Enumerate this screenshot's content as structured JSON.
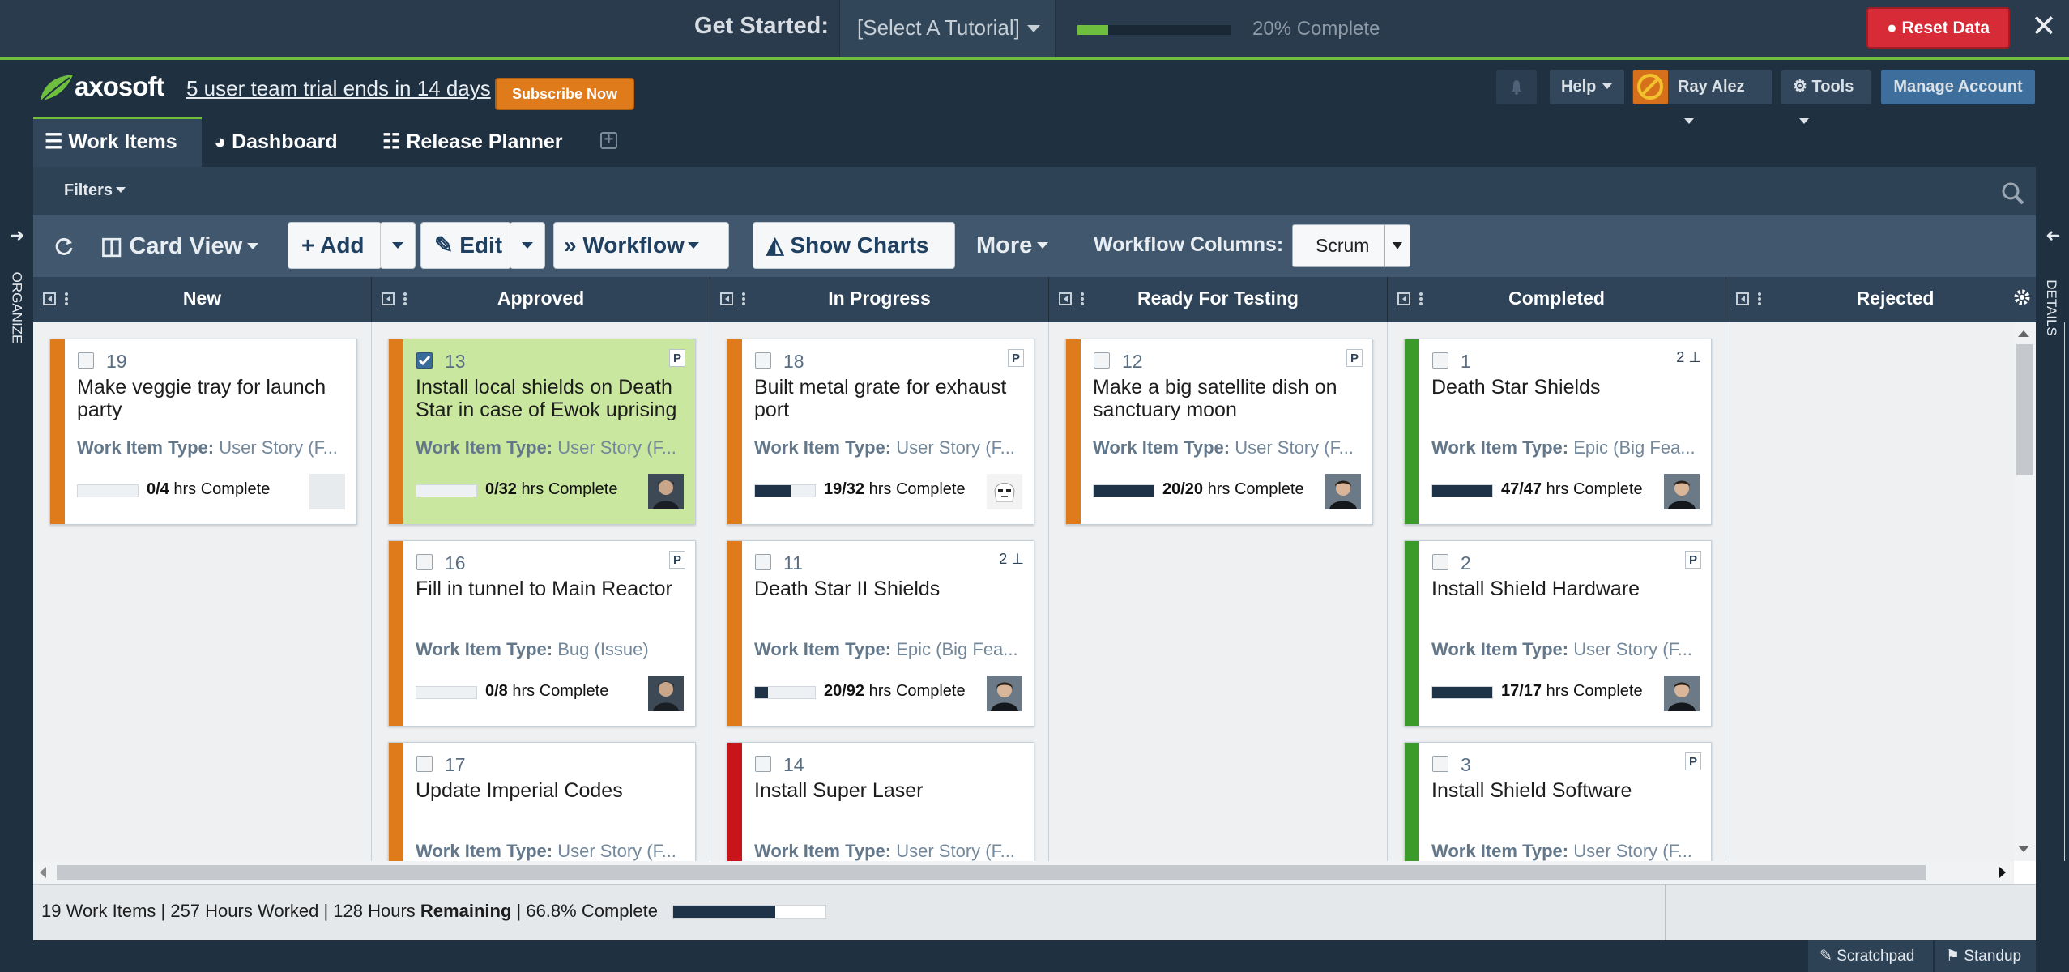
{
  "get_started": {
    "label": "Get Started:",
    "tutorial_select": "[Select A Tutorial]",
    "progress_fraction": 0.2,
    "progress_text": "20% Complete",
    "reset_label": "Reset Data",
    "close_symbol": "✕"
  },
  "header": {
    "logo_text": "axosoft",
    "trial_text": "5 user team trial ends in 14 days",
    "subscribe_label": "Subscribe Now",
    "help_label": "Help",
    "user_name": "Ray Alez",
    "tools_label": "Tools",
    "manage_label": "Manage Account"
  },
  "tabs": [
    {
      "label": "Work Items",
      "icon": "list-icon"
    },
    {
      "label": "Dashboard",
      "icon": "gauge-icon"
    },
    {
      "label": "Release Planner",
      "icon": "planner-icon"
    }
  ],
  "filters_label": "Filters",
  "toolbar": {
    "card_view_label": "Card View",
    "add_label": "Add",
    "edit_label": "Edit",
    "workflow_label": "Workflow",
    "show_charts_label": "Show Charts",
    "more_label": "More",
    "workflow_columns_label": "Workflow Columns:",
    "workflow_columns_value": "Scrum"
  },
  "columns": [
    {
      "name": "New",
      "cards": [
        {
          "id": "19",
          "title": "Make veggie tray for launch party",
          "type_label": "Work Item Type:",
          "type_value": "User Story (F...",
          "hrs": "0/4",
          "progress": 0.0,
          "stripe": "#e07b1c",
          "avatar": "blank",
          "flag": "",
          "children": "",
          "checked": false
        }
      ]
    },
    {
      "name": "Approved",
      "cards": [
        {
          "id": "13",
          "title": "Install local shields on Death Star in case of Ewok uprising",
          "type_label": "Work Item Type:",
          "type_value": "User Story (F...",
          "hrs": "0/32",
          "progress": 0.0,
          "stripe": "#e07b1c",
          "avatar": "person-dark",
          "flag": "P",
          "children": "",
          "checked": true
        },
        {
          "id": "16",
          "title": "Fill in tunnel to Main Reactor",
          "type_label": "Work Item Type:",
          "type_value": "Bug (Issue)",
          "hrs": "0/8",
          "progress": 0.0,
          "stripe": "#e07b1c",
          "avatar": "person-dark",
          "flag": "P",
          "children": "",
          "checked": false
        },
        {
          "id": "17",
          "title": "Update Imperial Codes",
          "type_label": "Work Item Type:",
          "type_value": "User Story (F...",
          "hrs": "",
          "progress": 0.0,
          "stripe": "#e07b1c",
          "avatar": "",
          "flag": "",
          "children": "",
          "checked": false
        }
      ]
    },
    {
      "name": "In Progress",
      "cards": [
        {
          "id": "18",
          "title": "Built metal grate for exhaust port",
          "type_label": "Work Item Type:",
          "type_value": "User Story (F...",
          "hrs": "19/32",
          "progress": 0.59,
          "stripe": "#e07b1c",
          "avatar": "trooper",
          "flag": "P",
          "children": "",
          "checked": false
        },
        {
          "id": "11",
          "title": "Death Star II Shields",
          "type_label": "Work Item Type:",
          "type_value": "Epic (Big Fea...",
          "hrs": "20/92",
          "progress": 0.22,
          "stripe": "#e07b1c",
          "avatar": "person-suit",
          "flag": "",
          "children": "2",
          "checked": false
        },
        {
          "id": "14",
          "title": "Install Super Laser",
          "type_label": "Work Item Type:",
          "type_value": "User Story (F...",
          "hrs": "",
          "progress": 0.0,
          "stripe": "#c8141b",
          "avatar": "",
          "flag": "",
          "children": "",
          "checked": false
        }
      ]
    },
    {
      "name": "Ready For Testing",
      "cards": [
        {
          "id": "12",
          "title": "Make a big satellite dish on sanctuary moon",
          "type_label": "Work Item Type:",
          "type_value": "User Story (F...",
          "hrs": "20/20",
          "progress": 1.0,
          "stripe": "#e07b1c",
          "avatar": "person-suit",
          "flag": "P",
          "children": "",
          "checked": false
        }
      ]
    },
    {
      "name": "Completed",
      "cards": [
        {
          "id": "1",
          "title": "Death Star Shields",
          "type_label": "Work Item Type:",
          "type_value": "Epic (Big Fea...",
          "hrs": "47/47",
          "progress": 1.0,
          "stripe": "#3a9a2a",
          "avatar": "person-suit",
          "flag": "",
          "children": "2",
          "checked": false
        },
        {
          "id": "2",
          "title": "Install Shield Hardware",
          "type_label": "Work Item Type:",
          "type_value": "User Story (F...",
          "hrs": "17/17",
          "progress": 1.0,
          "stripe": "#3a9a2a",
          "avatar": "person-suit",
          "flag": "P",
          "children": "",
          "checked": false
        },
        {
          "id": "3",
          "title": "Install Shield Software",
          "type_label": "Work Item Type:",
          "type_value": "User Story (F...",
          "hrs": "",
          "progress": 0.0,
          "stripe": "#3a9a2a",
          "avatar": "",
          "flag": "P",
          "children": "",
          "checked": false
        }
      ]
    },
    {
      "name": "Rejected",
      "cards": []
    }
  ],
  "hrs_suffix": "hrs Complete",
  "status": {
    "items_text": "19 Work Items | 257 Hours Worked | 128 Hours ",
    "remaining_label": "Remaining",
    "complete_text": " | 66.8% Complete",
    "progress_fraction": 0.668
  },
  "bottom": {
    "scratchpad_label": "Scratchpad",
    "standup_label": "Standup"
  },
  "side": {
    "left_label": "ORGANIZE",
    "right_label": "DETAILS"
  },
  "colors": {
    "accent_green": "#6fbf3f",
    "reset_red": "#d72c37",
    "subscribe_orange": "#e07b1c",
    "manage_blue": "#3d6e9c"
  }
}
